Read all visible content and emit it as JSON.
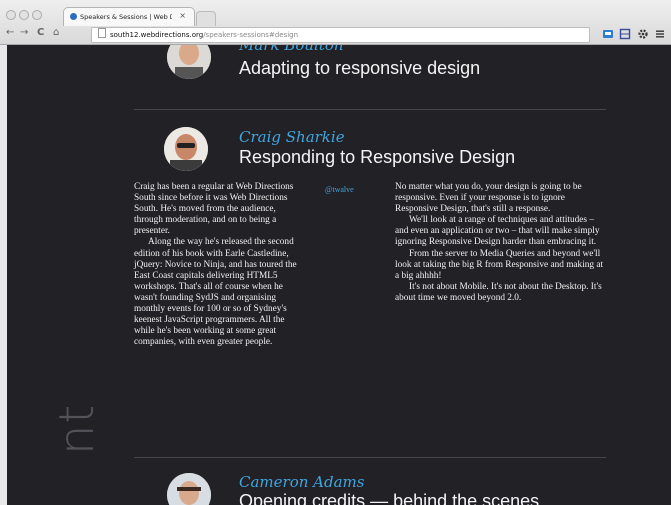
{
  "browser": {
    "tab_title": "Speakers & Sessions | Web D",
    "tab_close": "×",
    "url_host": "south12.webdirections.org",
    "url_path": "/speakers-sessions#design",
    "nav": {
      "back": "←",
      "forward": "→",
      "reload": "C",
      "home": "⌂"
    }
  },
  "speakers": [
    {
      "name": "Mark Boulton",
      "talk": "Adapting to responsive design"
    },
    {
      "name": "Craig Sharkie",
      "talk": "Responding to Responsive Design",
      "handle": "@twalve",
      "bio": [
        "Craig has been a regular at Web Directions South since before it was Web Directions South. He's moved from the audience, through moderation, and on to being a presenter.",
        "Along the way he's released the second edition of his book with Earle Castledine, jQuery: Novice to Ninja, and has toured the East Coast capitals delivering HTML5 workshops. That's all of course when he wasn't founding SydJS and organising monthly events for 100 or so of Sydney's keenest JavaScript programmers. All the while he's been working at some great companies, with even greater people."
      ],
      "abstract": [
        "No matter what you do, your design is going to be responsive. Even if your response is to ignore Responsive Design, that's still a response.",
        "We'll look at a range of techniques and attitudes – and even an application or two – that will make simply ignoring Responsive Design harder than embracing it.",
        "From the server to Media Queries and beyond we'll look at taking the big R from Responsive and making at a big ahhhh!",
        "It's not about Mobile. It's not about the Desktop. It's about time we moved beyond 2.0."
      ]
    },
    {
      "name": "Cameron Adams",
      "talk": "Opening credits — behind the scenes"
    }
  ],
  "side_text": "nt"
}
